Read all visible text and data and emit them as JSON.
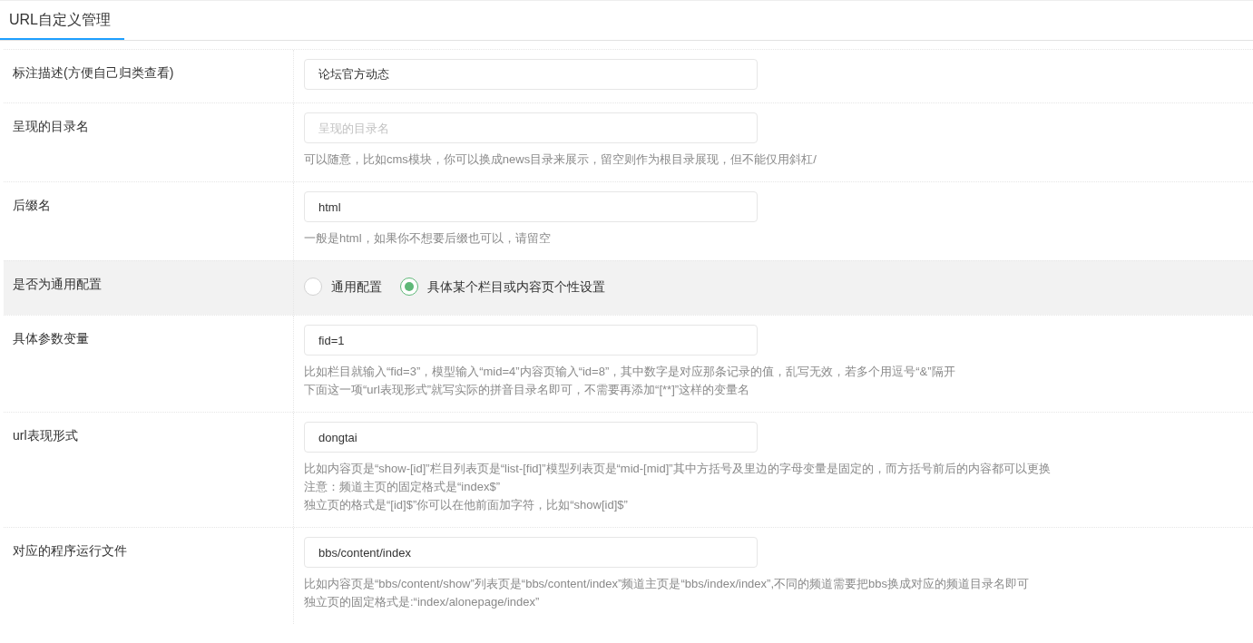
{
  "tab": {
    "label": "URL自定义管理",
    "selected": true
  },
  "rows": [
    {
      "kind": "text",
      "label": "标注描述(方便自己归类查看)",
      "highlighted": false,
      "value": "论坛官方动态",
      "hints": []
    },
    {
      "kind": "text",
      "label": "呈现的目录名",
      "highlighted": false,
      "placeholder": "呈现的目录名",
      "hints": [
        "可以随意，比如cms模块，你可以换成news目录来展示，留空则作为根目录展现，但不能仅用斜杠/"
      ]
    },
    {
      "kind": "text",
      "label": "后缀名",
      "highlighted": false,
      "value": "html",
      "hints": [
        "一般是html，如果你不想要后缀也可以，请留空"
      ]
    },
    {
      "kind": "radio",
      "label": "是否为通用配置",
      "highlighted": true,
      "options": [
        {
          "label": "通用配置",
          "selected": false
        },
        {
          "label": "具体某个栏目或内容页个性设置",
          "selected": true
        }
      ]
    },
    {
      "kind": "text",
      "label": "具体参数变量",
      "highlighted": false,
      "value": "fid=1",
      "hints": [
        "比如栏目就输入“fid=3”，模型输入“mid=4”内容页输入“id=8”，其中数字是对应那条记录的值，乱写无效，若多个用逗号“&”隔开",
        "下面这一项“url表现形式”就写实际的拼音目录名即可，不需要再添加“[**]”这样的变量名"
      ]
    },
    {
      "kind": "text",
      "label": "url表现形式",
      "highlighted": false,
      "value": "dongtai",
      "hints": [
        "比如内容页是“show-[id]”栏目列表页是“list-[fid]”模型列表页是“mid-[mid]”其中方括号及里边的字母变量是固定的，而方括号前后的内容都可以更换",
        "注意：频道主页的固定格式是“index$”",
        "独立页的格式是“[id]$”你可以在他前面加字符，比如“show[id]$”"
      ]
    },
    {
      "kind": "text",
      "label": "对应的程序运行文件",
      "highlighted": false,
      "value": "bbs/content/index",
      "hints": [
        "比如内容页是“bbs/content/show”列表页是“bbs/content/index”频道主页是“bbs/index/index”,不同的频道需要把bbs换成对应的频道目录名即可",
        "独立页的固定格式是:“index/alonepage/index”"
      ]
    }
  ]
}
